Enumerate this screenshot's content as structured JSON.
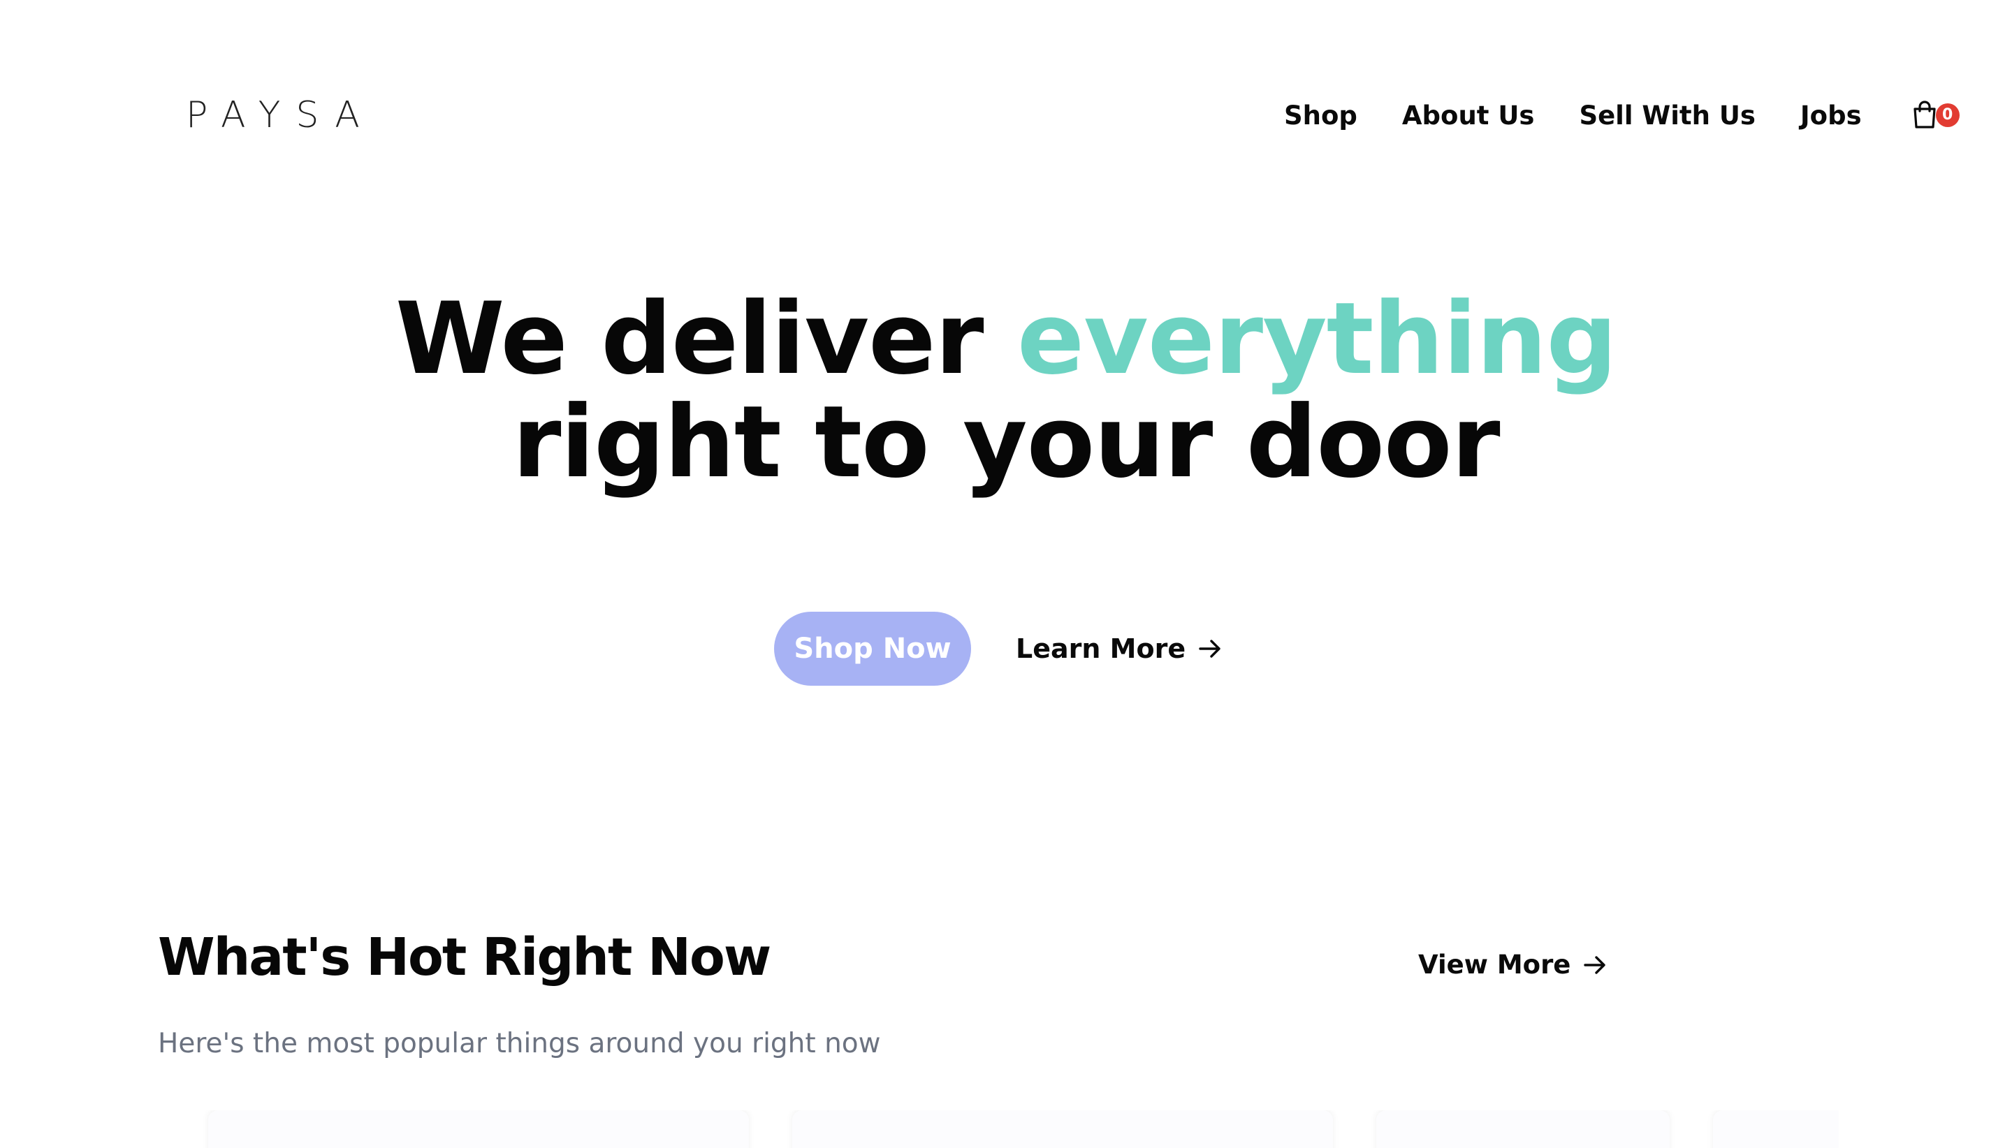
{
  "brand": {
    "logo_text": "PAYSA"
  },
  "nav": {
    "items": [
      {
        "label": "Shop"
      },
      {
        "label": "About Us"
      },
      {
        "label": "Sell With Us"
      },
      {
        "label": "Jobs"
      }
    ],
    "cart": {
      "icon": "shopping-bag-icon",
      "count": "0",
      "badge_color": "#e23c32"
    }
  },
  "hero": {
    "title_part1": "We deliver",
    "title_accent": "everything",
    "title_line2": "right to your door",
    "accent_color": "#6dd3c2",
    "primary_button": "Shop Now",
    "primary_button_color": "#a7b2f4",
    "secondary_button": "Learn More",
    "secondary_icon": "arrow-right-icon"
  },
  "section": {
    "title": "What's Hot Right Now",
    "subtitle": "Here's the most popular things around you right now",
    "view_more": "View More",
    "view_more_icon": "arrow-right-icon"
  }
}
